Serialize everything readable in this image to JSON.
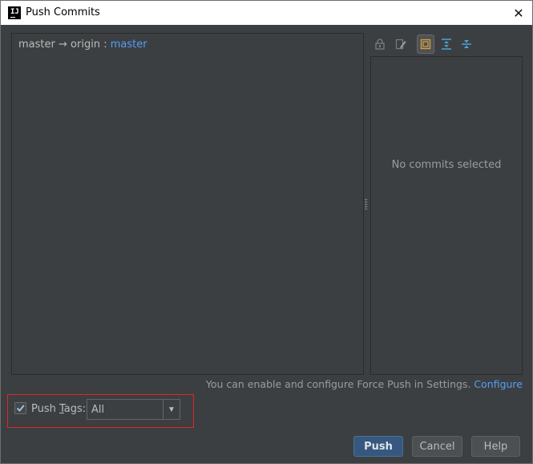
{
  "window": {
    "title": "Push Commits",
    "icon": "intellij-app-icon",
    "close_glyph": "✕"
  },
  "push_target": {
    "local_branch": "master",
    "arrow": "→",
    "remote": "origin",
    "separator": ":",
    "remote_branch": "master"
  },
  "details_toolbar": {
    "icons": [
      "lock-icon",
      "edit-icon",
      "show-details-icon",
      "expand-all-icon",
      "collapse-all-icon"
    ],
    "active_icon": "show-details-icon"
  },
  "details_panel": {
    "empty_message": "No commits selected"
  },
  "force_push_note": {
    "text": "You can enable and configure Force Push in Settings.",
    "link": "Configure"
  },
  "push_tags": {
    "checked": true,
    "label_before": "Push ",
    "label_mnemonic": "T",
    "label_after": "ags:",
    "selected": "All"
  },
  "buttons": {
    "push": "Push",
    "cancel": "Cancel",
    "help": "Help"
  },
  "colors": {
    "dialog_background": "#3c3f41",
    "link": "#589df6",
    "highlight_border": "#e0262b",
    "primary_button": "#365880"
  }
}
